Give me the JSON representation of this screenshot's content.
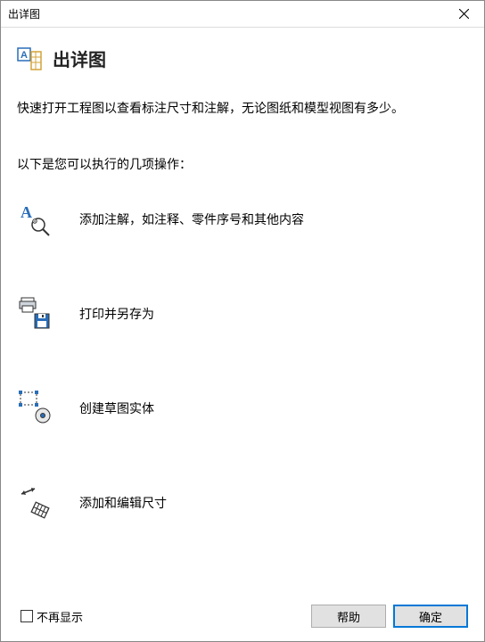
{
  "window": {
    "title": "出详图"
  },
  "heading": {
    "text": "出详图"
  },
  "intro": "快速打开工程图以查看标注尺寸和注解，无论图纸和模型视图有多少。",
  "ops_label": "以下是您可以执行的几项操作：",
  "ops": [
    {
      "text": "添加注解，如注释、零件序号和其他内容"
    },
    {
      "text": "打印并另存为"
    },
    {
      "text": "创建草图实体"
    },
    {
      "text": "添加和编辑尺寸"
    }
  ],
  "footer": {
    "dont_show": "不再显示",
    "help": "帮助",
    "ok": "确定"
  }
}
